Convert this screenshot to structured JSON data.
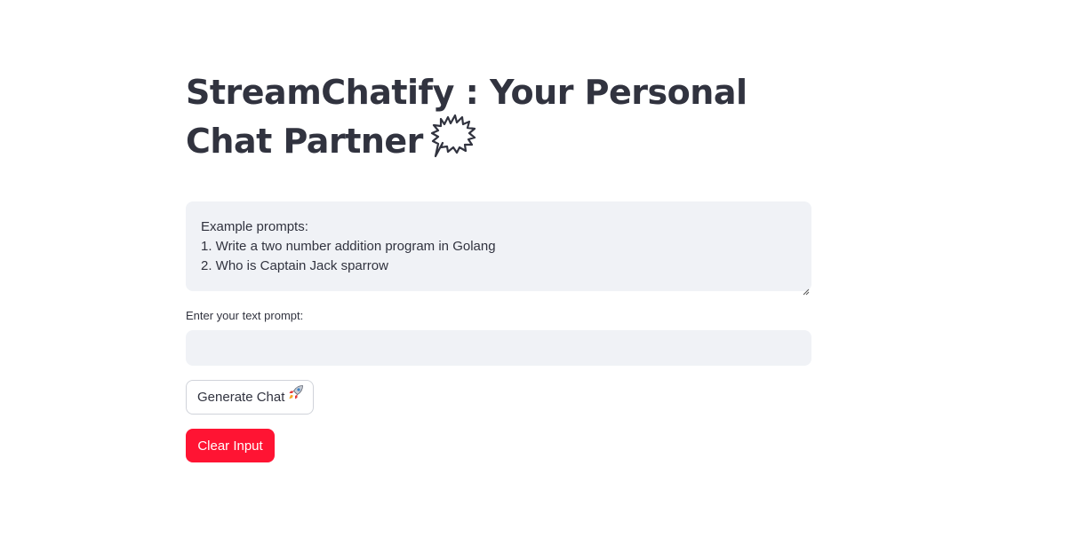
{
  "page": {
    "title": "StreamChatify : Your Personal Chat Partner",
    "title_icon": "speech-bubble-icon"
  },
  "example_box": {
    "lines": [
      "Example prompts:",
      "1. Write a two number addition program in Golang",
      "2. Who is Captain Jack sparrow"
    ]
  },
  "prompt": {
    "label": "Enter your text prompt:",
    "value": "",
    "placeholder": ""
  },
  "buttons": {
    "generate_label": "Generate Chat",
    "generate_icon": "rocket-icon",
    "clear_label": "Clear Input"
  },
  "colors": {
    "text": "#31333f",
    "input_bg": "#f0f2f6",
    "clear_button": "#ff1433",
    "accent_border": "#d0d3da"
  }
}
